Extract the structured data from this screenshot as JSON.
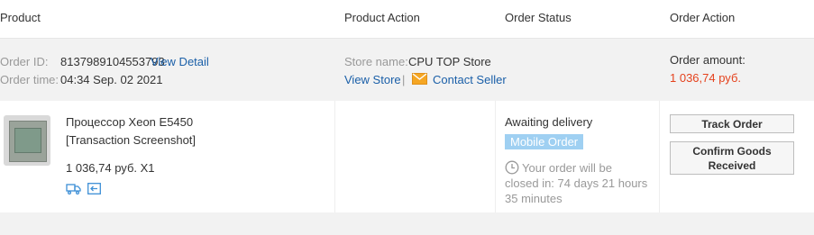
{
  "header": {
    "product": "Product",
    "product_action": "Product Action",
    "order_status": "Order Status",
    "order_action": "Order Action"
  },
  "order": {
    "id_label": "Order ID:",
    "id_value": "8137989104553793",
    "view_detail": "View Detail",
    "time_label": "Order time:",
    "time_value": "04:34 Sep. 02 2021",
    "store_label": "Store name:",
    "store_value": "CPU TOP Store",
    "view_store": "View Store",
    "separator": "|",
    "contact_seller": "Contact Seller",
    "amount_label": "Order amount:",
    "amount_value": "1 036,74 руб."
  },
  "item": {
    "title_line1": "Процессор Xeon E5450",
    "title_line2": "[Transaction Screenshot]",
    "price_qty": "1 036,74 руб. X1",
    "status": "Awaiting delivery",
    "badge": "Mobile Order",
    "receive_line1": "Your order will be",
    "receive_line2": "closed in: 74 days 21 hours",
    "receive_line3": "35 minutes"
  },
  "actions": {
    "track": "Track Order",
    "confirm_line1": "Confirm Goods",
    "confirm_line2": "Received"
  },
  "colors": {
    "link": "#1a5fa8",
    "amount": "#e5421d",
    "badge": "#9fd0f2",
    "mail_icon": "#f5a623"
  },
  "icons": [
    "mail-icon",
    "clock-icon",
    "shipping-truck-icon",
    "return-icon"
  ]
}
